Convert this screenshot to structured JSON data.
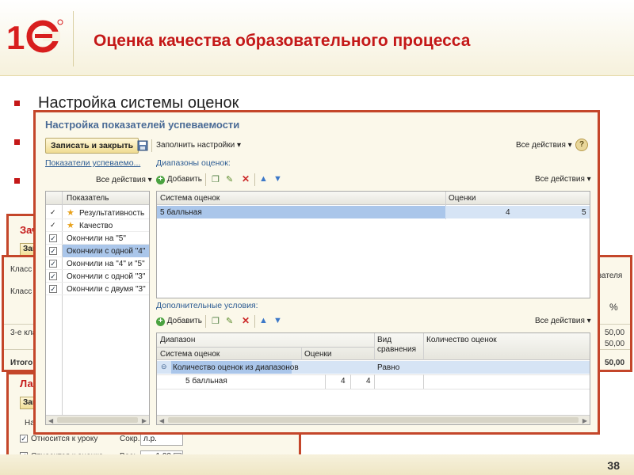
{
  "slide": {
    "title": "Оценка качества образовательного процесса",
    "bullet_1": "Настройка системы оценок",
    "page_number": "38"
  },
  "background": {
    "win_left_title": "Зач",
    "win_left_btn": "Запи",
    "table_header_1": "Класс",
    "table_header_2": "Класс",
    "row_3": "3-е кла",
    "total": "Итого",
    "right_header": "азателя",
    "percent": "%",
    "val_1": "50,00",
    "val_2": "50,00",
    "val_total": "50,00",
    "win2_title": "Ла",
    "win2_btn": "Запи",
    "win2_name": "Наим",
    "lesson_label": "Относится к уроку",
    "short_label": "Сокр.:",
    "short_value": "л.р.",
    "grade_label": "Относится к оценке",
    "weight_label": "Вес:",
    "weight_value": "1,00"
  },
  "dialog": {
    "title": "Настройка показателей успеваемости",
    "save_close": "Записать и закрыть",
    "fill_settings": "Заполнить настройки",
    "all_actions": "Все действия",
    "help": "?",
    "left_section": "Показатели успеваемо...",
    "left_all_actions": "Все действия",
    "left_header": "Показатель",
    "indicators": [
      {
        "label": "Результативность",
        "star": true
      },
      {
        "label": "Качество",
        "star": true
      },
      {
        "label": "Окончили на \"5\""
      },
      {
        "label": "Окончили с одной \"4\"",
        "selected": true
      },
      {
        "label": "Окончили на \"4\" и \"5\""
      },
      {
        "label": "Окончили с одной \"3\""
      },
      {
        "label": "Окончили с двумя \"3\""
      }
    ],
    "ranges_section": "Диапазоны оценок:",
    "add": "Добавить",
    "ranges_all_actions": "Все действия",
    "ranges_header_system": "Система оценок",
    "ranges_header_grades": "Оценки",
    "ranges_row": {
      "system": "5 балльная",
      "from": "4",
      "to": "5"
    },
    "extra_section": "Дополнительные условия:",
    "extra_add": "Добавить",
    "extra_all_actions": "Все действия",
    "extra_header_range": "Диапазон",
    "extra_header_system": "Система оценок",
    "extra_header_grades": "Оценки",
    "extra_header_compare": "Вид\nсравнения",
    "extra_header_count": "Количество оценок",
    "extra_row_1": {
      "range": "Количество оценок из диапазонов",
      "compare": "Равно"
    },
    "extra_row_2": {
      "system": "5 балльная",
      "from": "4",
      "to": "4"
    }
  },
  "colors": {
    "title_red": "#c41818",
    "frame": "#c4462a",
    "dialog_bg": "#fbf8ea",
    "selection": "#aac6ea"
  }
}
